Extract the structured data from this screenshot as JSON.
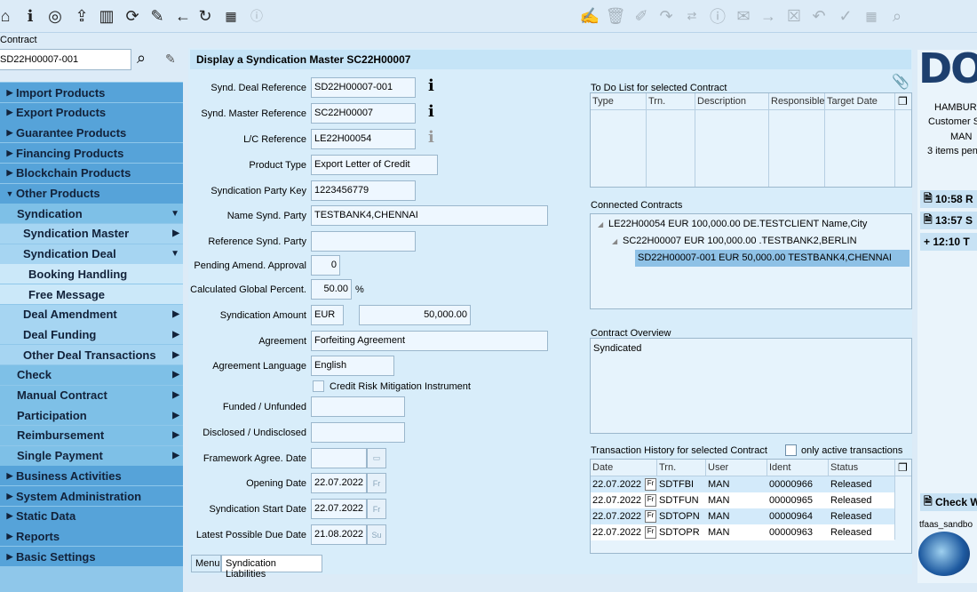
{
  "toolbar": {
    "left_icons": [
      "home-icon",
      "info-icon",
      "target-icon",
      "import-icon",
      "book-icon",
      "refresh-cycle-icon",
      "edit-icon",
      "back-arrow-icon",
      "reload-icon",
      "calendar-icon",
      "info-box-icon"
    ],
    "right_icons": [
      "sign-icon",
      "delete-icon",
      "attach-edit-icon",
      "forward-icon",
      "swap-icon",
      "details-icon",
      "mail-icon",
      "next-icon",
      "cancel-icon",
      "undo-icon",
      "check-icon",
      "calendar2-icon",
      "search-icon"
    ]
  },
  "contract": {
    "label": "Contract",
    "value": "SD22H00007-001"
  },
  "nav": {
    "items": [
      {
        "label": "Import Products",
        "level": "l1",
        "caret": "▶"
      },
      {
        "label": "Export Products",
        "level": "l1",
        "caret": "▶"
      },
      {
        "label": "Guarantee Products",
        "level": "l1",
        "caret": "▶"
      },
      {
        "label": "Financing Products",
        "level": "l1",
        "caret": "▶"
      },
      {
        "label": "Blockchain Products",
        "level": "l1",
        "caret": "▶"
      },
      {
        "label": "Other Products",
        "level": "l1",
        "caret": "▼"
      },
      {
        "label": "Syndication",
        "level": "l2",
        "caret": "",
        "arrow": "▼"
      },
      {
        "label": "Syndication Master",
        "level": "l3",
        "caret": "",
        "arrow": "▶"
      },
      {
        "label": "Syndication Deal",
        "level": "l3",
        "caret": "",
        "arrow": "▼"
      },
      {
        "label": "Booking Handling",
        "level": "l4",
        "caret": "",
        "arrow": ""
      },
      {
        "label": "Free Message",
        "level": "l4",
        "caret": "",
        "arrow": ""
      },
      {
        "label": "Deal Amendment",
        "level": "l3",
        "caret": "",
        "arrow": "▶"
      },
      {
        "label": "Deal Funding",
        "level": "l3",
        "caret": "",
        "arrow": "▶"
      },
      {
        "label": "Other Deal Transactions",
        "level": "l3",
        "caret": "",
        "arrow": "▶"
      },
      {
        "label": "Check",
        "level": "l2",
        "caret": "",
        "arrow": "▶"
      },
      {
        "label": "Manual Contract",
        "level": "l2",
        "caret": "",
        "arrow": "▶"
      },
      {
        "label": "Participation",
        "level": "l2",
        "caret": "",
        "arrow": "▶"
      },
      {
        "label": "Reimbursement",
        "level": "l2",
        "caret": "",
        "arrow": "▶"
      },
      {
        "label": "Single Payment",
        "level": "l2",
        "caret": "",
        "arrow": "▶"
      },
      {
        "label": "Business Activities",
        "level": "l1",
        "caret": "▶"
      },
      {
        "label": "System Administration",
        "level": "l1",
        "caret": "▶"
      },
      {
        "label": "Static Data",
        "level": "l1",
        "caret": "▶"
      },
      {
        "label": "Reports",
        "level": "l1",
        "caret": "▶"
      },
      {
        "label": "Basic Settings",
        "level": "l1",
        "caret": "▶"
      }
    ]
  },
  "main": {
    "title": "Display a Syndication Master SC22H00007",
    "fields": {
      "synd_deal_ref": {
        "label": "Synd. Deal Reference",
        "value": "SD22H00007-001"
      },
      "synd_master_ref": {
        "label": "Synd. Master Reference",
        "value": "SC22H00007"
      },
      "lc_ref": {
        "label": "L/C Reference",
        "value": "LE22H00054"
      },
      "product_type": {
        "label": "Product Type",
        "value": "Export Letter of Credit"
      },
      "party_key": {
        "label": "Syndication Party Key",
        "value": "1223456779"
      },
      "name_party": {
        "label": "Name Synd. Party",
        "value": "TESTBANK4,CHENNAI"
      },
      "ref_party": {
        "label": "Reference Synd. Party",
        "value": ""
      },
      "pending": {
        "label": "Pending Amend. Approval",
        "value": "0"
      },
      "global_pct": {
        "label": "Calculated Global Percent.",
        "value": "50.00",
        "unit": "%"
      },
      "amount": {
        "label": "Syndication Amount",
        "currency": "EUR",
        "value": "50,000.00"
      },
      "agreement": {
        "label": "Agreement",
        "value": "Forfeiting Agreement"
      },
      "agreement_lang": {
        "label": "Agreement Language",
        "value": "English"
      },
      "credit_risk": {
        "label": "Credit Risk Mitigation Instrument"
      },
      "funded": {
        "label": "Funded / Unfunded",
        "value": ""
      },
      "disclosed": {
        "label": "Disclosed / Undisclosed",
        "value": ""
      },
      "framework_date": {
        "label": "Framework Agree. Date",
        "value": ""
      },
      "opening_date": {
        "label": "Opening Date",
        "value": "22.07.2022",
        "cal": "Fr"
      },
      "start_date": {
        "label": "Syndication Start Date",
        "value": "22.07.2022",
        "cal": "Fr"
      },
      "due_date": {
        "label": "Latest Possible Due Date",
        "value": "21.08.2022",
        "cal": "Su"
      }
    }
  },
  "todo": {
    "title": "To Do List for selected Contract",
    "columns": [
      "Type",
      "Trn.",
      "Description",
      "Responsible",
      "Target Date"
    ]
  },
  "connected": {
    "title": "Connected Contracts",
    "rows": [
      "LE22H00054 EUR 100,000.00 DE.TESTCLIENT Name,City",
      "SC22H00007 EUR 100,000.00 .TESTBANK2,BERLIN",
      "SD22H00007-001 EUR 50,000.00 TESTBANK4,CHENNAI"
    ]
  },
  "overview": {
    "title": "Contract Overview",
    "text": "Syndicated"
  },
  "history": {
    "title": "Transaction History for selected Contract",
    "only_active": "only active transactions",
    "columns": [
      "Date",
      "Trn.",
      "User",
      "Ident",
      "Status"
    ],
    "rows": [
      {
        "date": "22.07.2022",
        "cal": "Fr",
        "trn": "SDTFBI",
        "user": "MAN",
        "ident": "00000966",
        "status": "Released"
      },
      {
        "date": "22.07.2022",
        "cal": "Fr",
        "trn": "SDTFUN",
        "user": "MAN",
        "ident": "00000965",
        "status": "Released"
      },
      {
        "date": "22.07.2022",
        "cal": "Fr",
        "trn": "SDTOPN",
        "user": "MAN",
        "ident": "00000964",
        "status": "Released"
      },
      {
        "date": "22.07.2022",
        "cal": "Fr",
        "trn": "SDTOPR",
        "user": "MAN",
        "ident": "00000963",
        "status": "Released"
      }
    ]
  },
  "tabs": {
    "menu": "Menu",
    "liabilities": "Syndication Liabilities"
  },
  "right": {
    "logo": "DO",
    "city": "HAMBUR",
    "customer": "Customer S",
    "user": "MAN",
    "pending": "3 items pen",
    "items": [
      "10:58 R",
      "13:57 S",
      "12:10 T"
    ],
    "check": "Check W",
    "sandbox": "tfaas_sandbo"
  },
  "colors": {
    "nav_l1": "#56a3d9",
    "nav_l2": "#7ec0e7",
    "title_bar": "#c5e4f7"
  }
}
